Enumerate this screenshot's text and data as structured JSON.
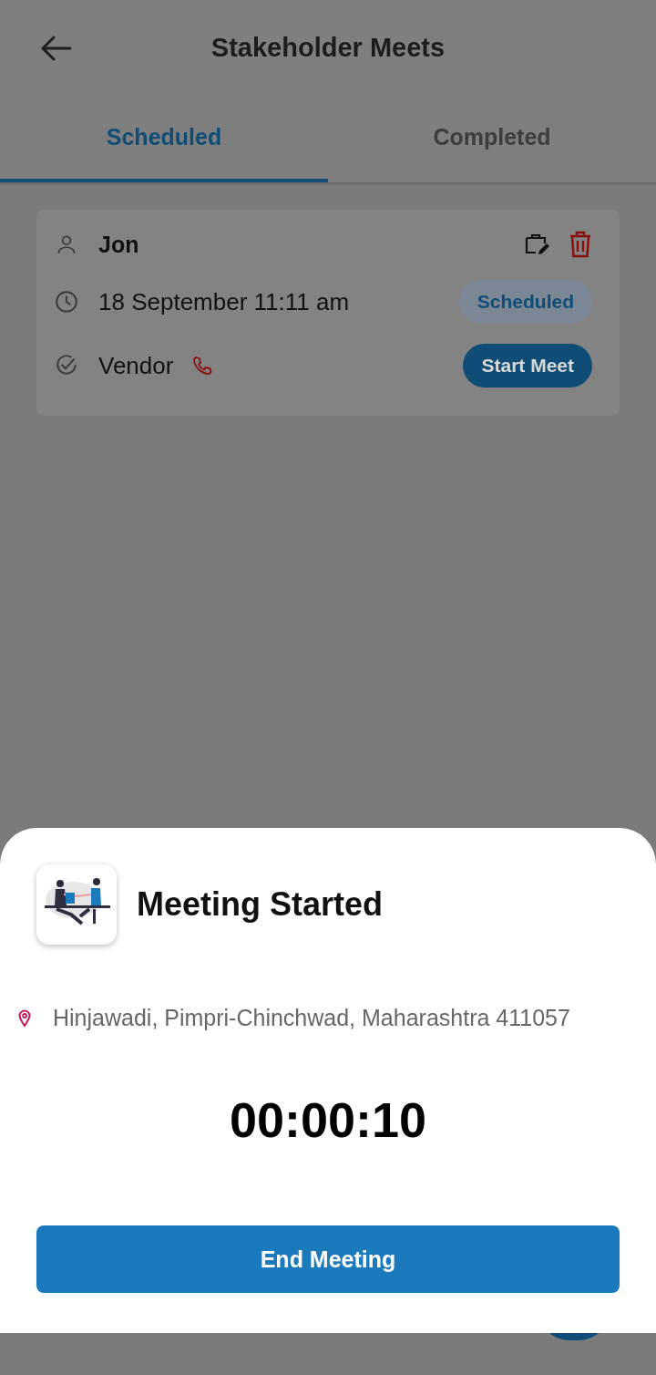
{
  "header": {
    "title": "Stakeholder Meets"
  },
  "tabs": [
    {
      "label": "Scheduled",
      "selected": true
    },
    {
      "label": "Completed",
      "selected": false
    }
  ],
  "meetings": [
    {
      "name": "Jon",
      "datetime": "18 September  11:11 am",
      "role": "Vendor",
      "status": "Scheduled",
      "action": "Start Meet"
    }
  ],
  "sheet": {
    "title": "Meeting Started",
    "location": "Hinjawadi, Pimpri-Chinchwad, Maharashtra 411057",
    "timer": "00:00:10",
    "button": "End Meeting"
  }
}
